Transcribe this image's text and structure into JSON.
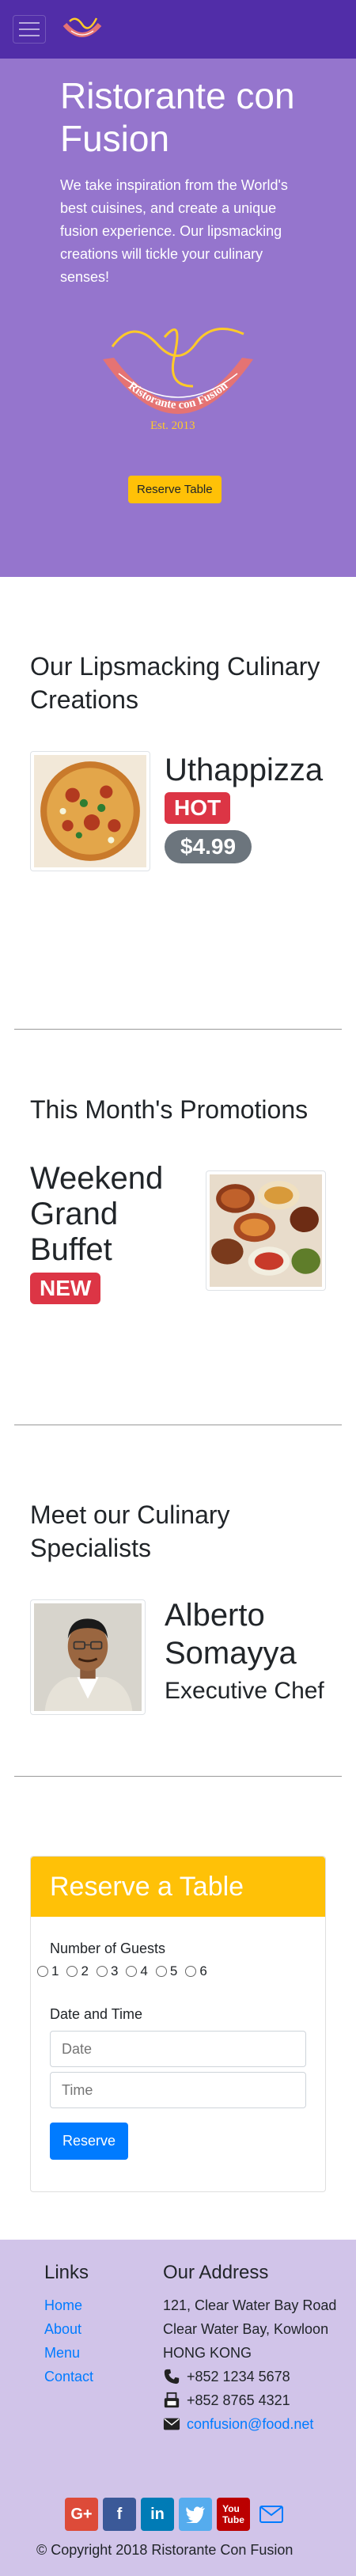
{
  "brand": {
    "title": "Ristorante con Fusion",
    "lead": "We take inspiration from the World's best cuisines, and create a unique fusion experience. Our lipsmacking creations will tickle your culinary senses!",
    "reserve_button": "Reserve Table",
    "logo_text": "Ristorante con Fusion",
    "logo_est": "Est. 2013"
  },
  "dish_section": {
    "heading": "Our Lipsmacking Culinary Creations",
    "name": "Uthappizza",
    "badge": "HOT",
    "price": "$4.99"
  },
  "promo_section": {
    "heading": "This Month's Promotions",
    "name": "Weekend Grand Buffet",
    "badge": "NEW"
  },
  "leader_section": {
    "heading": "Meet our Culinary Specialists",
    "name": "Alberto Somayya",
    "designation": "Executive Chef"
  },
  "reserve": {
    "header": "Reserve a Table",
    "guests_label": "Number of Guests",
    "guests_options": [
      "1",
      "2",
      "3",
      "4",
      "5",
      "6"
    ],
    "datetime_label": "Date and Time",
    "date_placeholder": "Date",
    "time_placeholder": "Time",
    "submit_label": "Reserve"
  },
  "footer": {
    "links_heading": "Links",
    "links": [
      "Home",
      "About",
      "Menu",
      "Contact"
    ],
    "address_heading": "Our Address",
    "address_lines": [
      "121, Clear Water Bay Road",
      "Clear Water Bay, Kowloon",
      "HONG KONG"
    ],
    "phone": "+852 1234 5678",
    "fax": "+852 8765 4321",
    "email": "confusion@food.net",
    "social": [
      "google-plus",
      "facebook",
      "linkedin",
      "twitter",
      "youtube",
      "mail"
    ],
    "copyright": "© Copyright 2018 Ristorante Con Fusion"
  },
  "colors": {
    "navbar": "#512da8",
    "jumbotron": "#9575cd",
    "footer": "#d1c4e9",
    "accent_yellow": "#ffc107",
    "badge_red": "#dc3545",
    "badge_grey": "#6c757d",
    "link_blue": "#007bff"
  }
}
